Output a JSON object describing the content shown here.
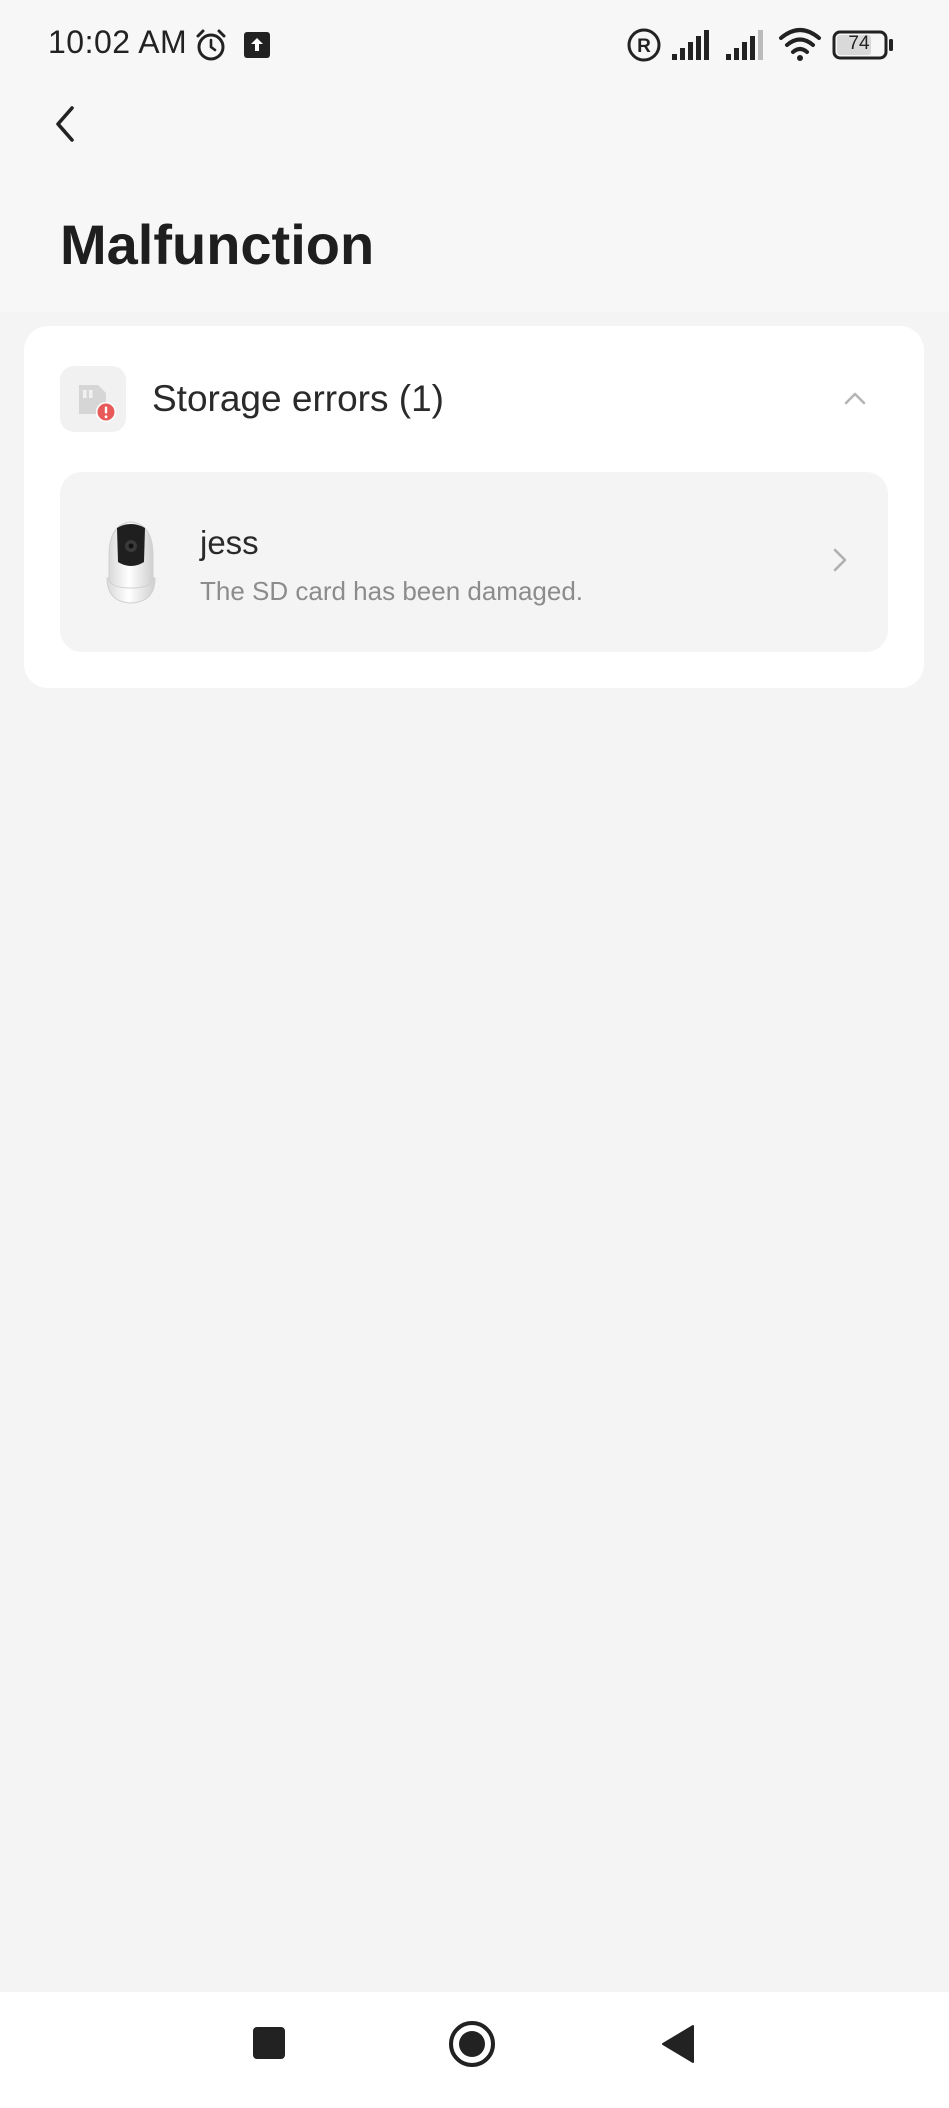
{
  "status_bar": {
    "time": "10:02 AM",
    "battery_level": "74",
    "icons": [
      "alarm-icon",
      "upload-icon",
      "registered-icon",
      "signal-icon",
      "signal-icon",
      "wifi-icon",
      "battery-icon"
    ]
  },
  "header": {
    "back_icon": "chevron-left-icon",
    "title": "Malfunction"
  },
  "groups": [
    {
      "icon": "sd-card-error-icon",
      "title": "Storage errors (1)",
      "expanded": true,
      "items": [
        {
          "icon": "camera-device-icon",
          "name": "jess",
          "message": "The SD card has been damaged."
        }
      ]
    }
  ],
  "nav_bar": {
    "buttons": [
      "recents-square-icon",
      "home-circle-icon",
      "back-triangle-icon"
    ]
  },
  "colors": {
    "background": "#f4f4f4",
    "card": "#ffffff",
    "list_item": "#f4f4f4",
    "error_badge": "#e85a5a",
    "secondary_text": "#8c8c8c"
  }
}
